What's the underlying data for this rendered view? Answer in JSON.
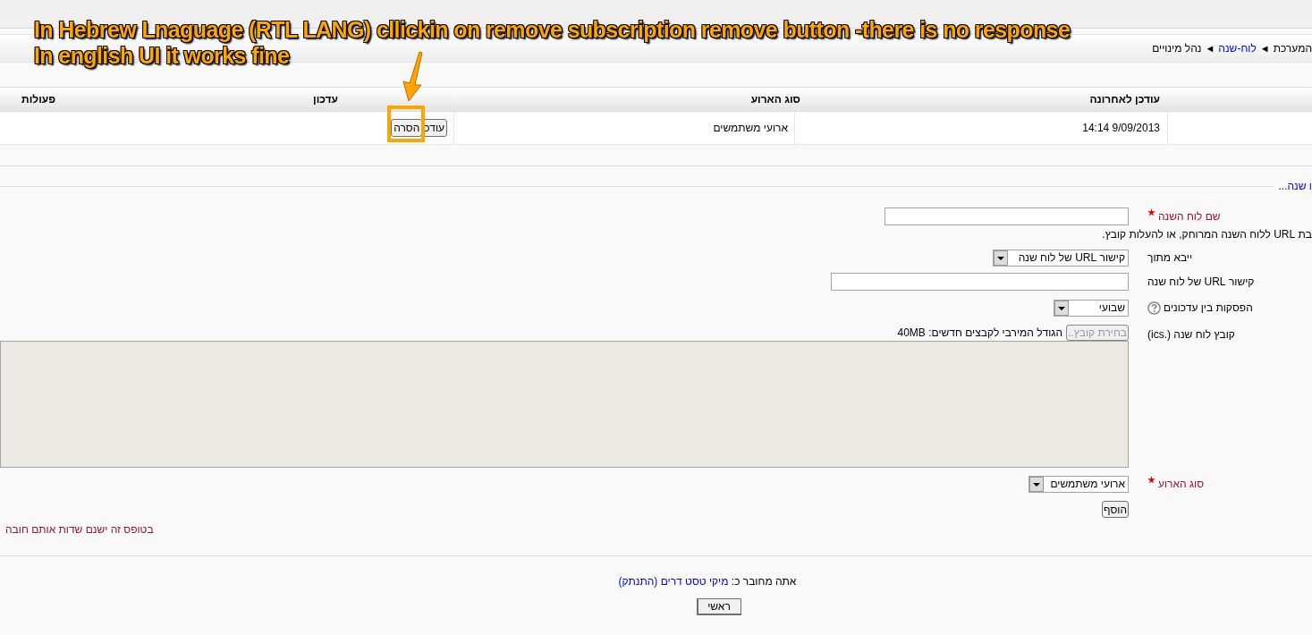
{
  "annotation": {
    "lines": [
      "In Hebrew Lnaguage (RTL LANG) cllickin on remove subscription remove button -there is no response",
      "In english UI it works fine"
    ]
  },
  "breadcrumb": {
    "separator": "◄",
    "items": [
      {
        "text": "המערכת",
        "link": false
      },
      {
        "text": "לוח-שנה",
        "link": true
      },
      {
        "text": "נהל מינויים",
        "link": false
      }
    ]
  },
  "table": {
    "columns": [
      "עודכן לאחרונה",
      "סוג הארוע",
      "עדכון",
      "פעולות"
    ],
    "rows": [
      {
        "last_updated": "14:14 9/09/2013",
        "event_type": "ארועי משתמשים",
        "buttons": [
          "עודכ",
          "הסרה"
        ]
      }
    ]
  },
  "section_link": "ו שנה...",
  "form": {
    "rows": [
      {
        "kind": "text",
        "label": "שם לוח השנה",
        "required": true
      },
      {
        "kind": "note",
        "text": "בת URL ללוח השנה המרוחק, או להעלות קובץ."
      },
      {
        "kind": "select",
        "label": "ייבא מתוך",
        "value": "קישור URL של לוח שנה",
        "required": false
      },
      {
        "kind": "text",
        "label": "קישור URL של לוח שנה",
        "required": false
      },
      {
        "kind": "select",
        "label": "הפסקות בין עדכונים",
        "value": "שבועי",
        "required": false,
        "help": true
      },
      {
        "kind": "file",
        "label": "קובץ לוח שנה (.ics)",
        "button": "בחירת קובץ..",
        "disabled": true,
        "note": "הגודל המירבי לקבצים חדשים: 40MB"
      },
      {
        "kind": "select",
        "label": "סוג הארוע",
        "value": "ארועי משתמשים",
        "required": true
      },
      {
        "kind": "submit",
        "button": "הוסף"
      }
    ],
    "required_note": "בטופס זה ישנם שדות אותם חובה"
  },
  "footer": {
    "prefix": "אתה מחובר כ:",
    "user": "מיקי טסט דרים",
    "logout": "(התנתק)",
    "home_button": "ראשי"
  }
}
